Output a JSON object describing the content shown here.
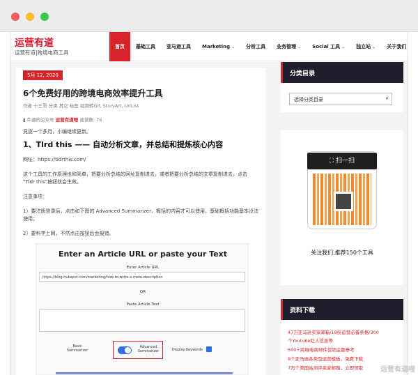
{
  "header": {
    "logo": "运营有道",
    "tagline": "运营有道|跨境电商工具"
  },
  "nav": [
    {
      "label": "首页",
      "dropdown": false,
      "active": true
    },
    {
      "label": "基础工具",
      "dropdown": false,
      "active": false
    },
    {
      "label": "亚马逊工具",
      "dropdown": false,
      "active": false
    },
    {
      "label": "Marketing",
      "dropdown": true,
      "active": false
    },
    {
      "label": "分析工具",
      "dropdown": false,
      "active": false
    },
    {
      "label": "业务管理",
      "dropdown": true,
      "active": false
    },
    {
      "label": "Social 工具",
      "dropdown": true,
      "active": false
    },
    {
      "label": "独立站",
      "dropdown": true,
      "active": false
    },
    {
      "label": "关于我们",
      "dropdown": false,
      "active": false
    }
  ],
  "article": {
    "date": "5月 12, 2020",
    "title": "6个免费好用的跨境电商效率提升工具",
    "meta_prefix": "作者  十三哥  分类  其它  标签  ",
    "tags": "视频转Gif, StoryArt, UrlList",
    "wx_prefix": "牛逼的公众号",
    "wx_name": "运营有道哩",
    "wx_suffix": "阅读数: 76",
    "intro": "竞逐一个多月，小编继续更新。",
    "h2": "1、Tlrd this —— 自动分析文章，并总结和提炼核心内容",
    "url_line": "网址：https://tldrthis.com/",
    "desc1": "这个工具的工作原理也和简单，把要分析总结的网址复制进去，或者把要分析总结的文章复制进去，点击",
    "desc2": "\"Tldr this\"按钮就会生效。",
    "note": "注意事项：",
    "note1a": "1）要注册登录后，点击如下图的 Advanced Summarizer，概括的内容才可以使用，基础概括功能基本没法",
    "note1b": "使用；",
    "note2": "2）要科学上网，不然点击按钮后会报错。"
  },
  "screenshot": {
    "title": "Enter an Article URL or paste your Text",
    "url_label": "Enter Article URL",
    "url_value": "https://blog.hubspot.com/marketing/how-to-write-a-meta-description",
    "or": "OR",
    "paste_label": "Paste Article Text",
    "basic": "Basic\nSummarizer",
    "advanced": "Advanced\nSummarizer",
    "display": "Display Keywords"
  },
  "sidebar": {
    "category_title": "分类目录",
    "category_select": "选择分类目录",
    "qr_label": "扫一扫",
    "qr_caption": "关注我们,推荐150个工具",
    "download_title": "资料下载",
    "downloads": [
      "47万亚马逊买家邮箱/18份运营必备表格/300",
      "个Youtube红人信息等",
      "500+跨境电商邮件营销主题参考",
      "8个亚马逊各类型运营模板，免费下载",
      "7万个美国站测评卖家邮箱，立即领取"
    ],
    "watermark": "运营有道哩"
  },
  "colors": {
    "accent": "#d8232a",
    "dark": "#1e1e2d"
  }
}
